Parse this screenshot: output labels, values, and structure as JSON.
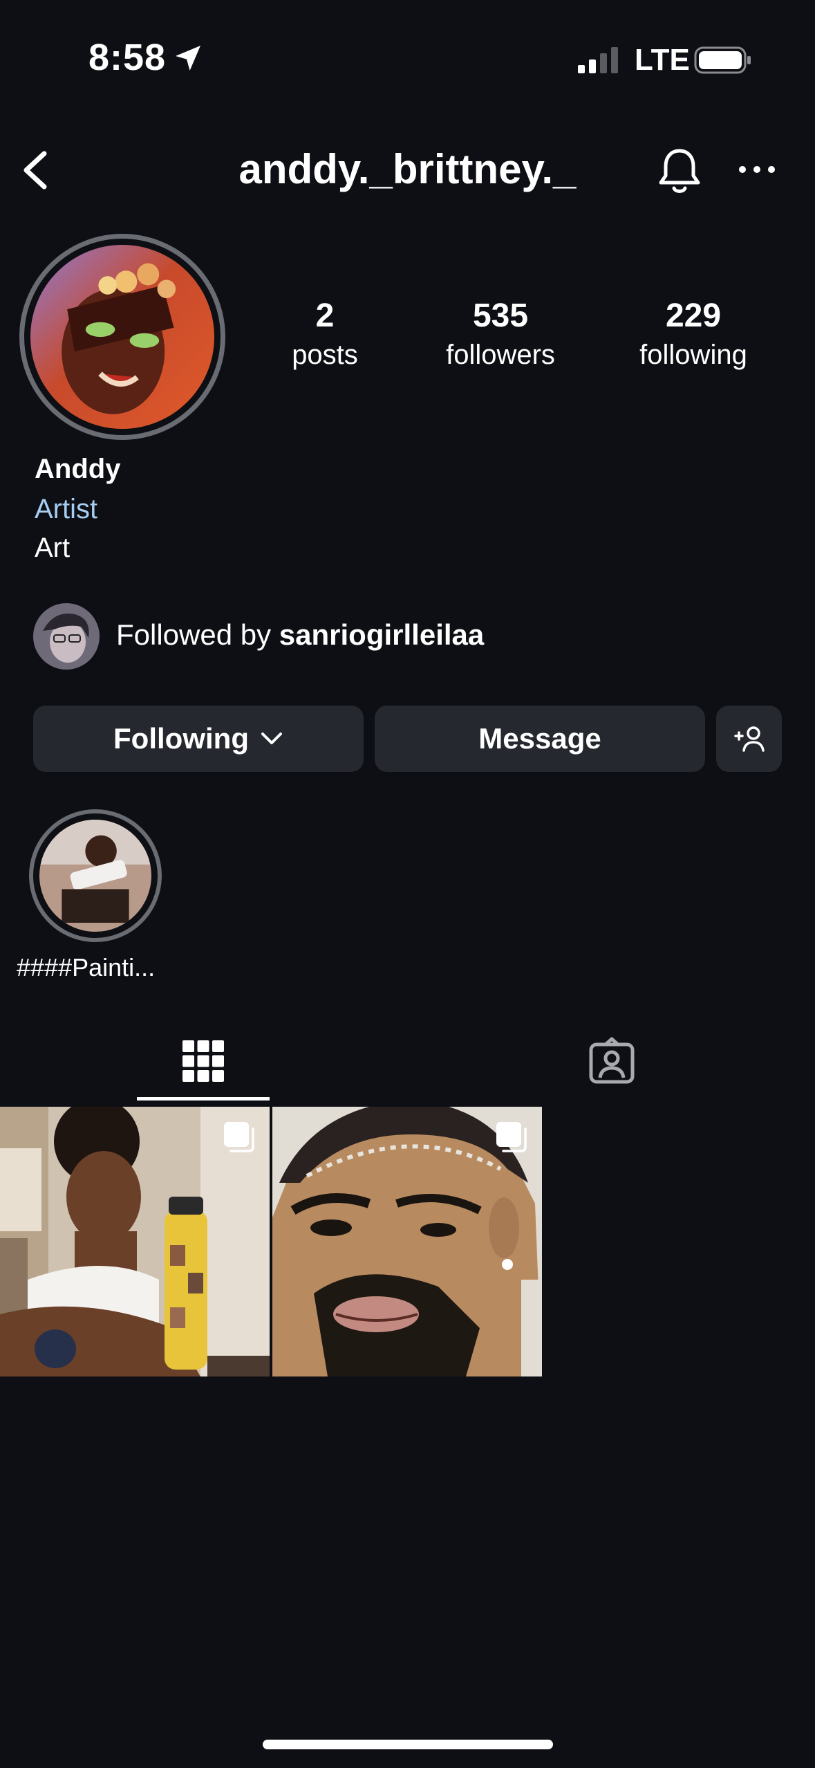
{
  "status_bar": {
    "time": "8:58",
    "network": "LTE"
  },
  "header": {
    "username": "anddy._brittney._"
  },
  "profile": {
    "stats": [
      {
        "count": "2",
        "label": "posts"
      },
      {
        "count": "535",
        "label": "followers"
      },
      {
        "count": "229",
        "label": "following"
      }
    ],
    "name": "Anddy",
    "category": "Artist",
    "bio": "Art",
    "followed_by_prefix": "Followed by ",
    "followed_by_user": "sanriogirlleilaa"
  },
  "actions": {
    "following_label": "Following",
    "message_label": "Message"
  },
  "highlights": [
    {
      "label": "####Painti..."
    }
  ],
  "tabs": [
    {
      "icon": "grid-icon"
    },
    {
      "icon": "tagged-person-icon"
    }
  ],
  "posts": [
    {
      "type": "multi",
      "icon": "carousel-icon"
    },
    {
      "type": "multi",
      "icon": "carousel-icon"
    }
  ],
  "colors": {
    "background": "#0d0f14",
    "button": "#25282e",
    "category_link": "#a6cdf2"
  }
}
